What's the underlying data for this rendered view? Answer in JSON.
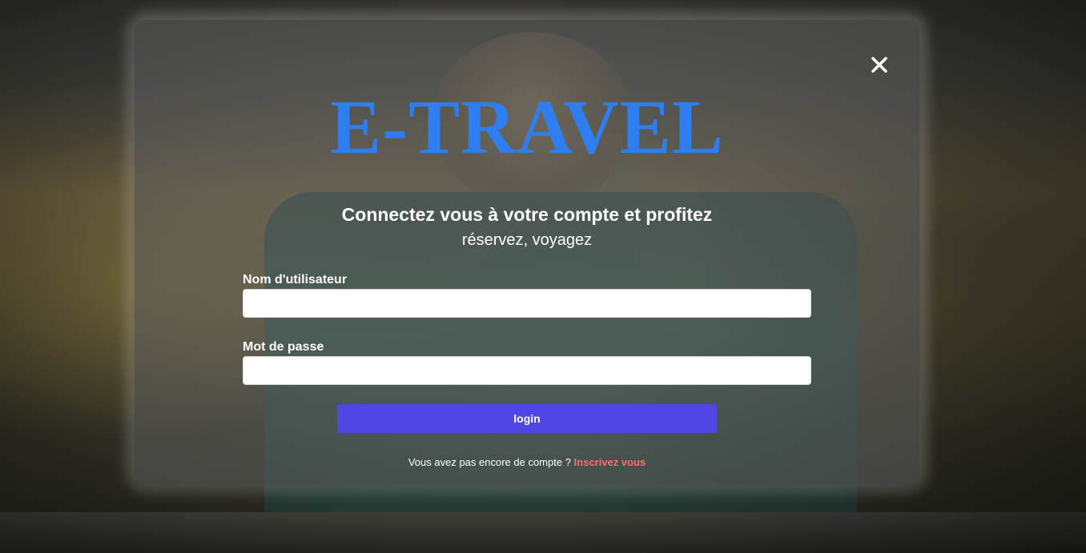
{
  "brand": {
    "title": "E-TRAVEL",
    "color": "#2f7ef0"
  },
  "header": {
    "headline": "Connectez vous à votre compte et profitez",
    "subline": "réservez, voyagez"
  },
  "form": {
    "username_label": "Nom d'utilisateur",
    "username_value": "",
    "password_label": "Mot de passe",
    "password_value": "",
    "login_label": "login",
    "login_color": "#4f46e5"
  },
  "footer": {
    "prompt": "Vous avez pas encore de compte ?",
    "signup_link": "Inscrivez vous",
    "link_color": "#f87171"
  },
  "icons": {
    "close": "close-icon"
  }
}
